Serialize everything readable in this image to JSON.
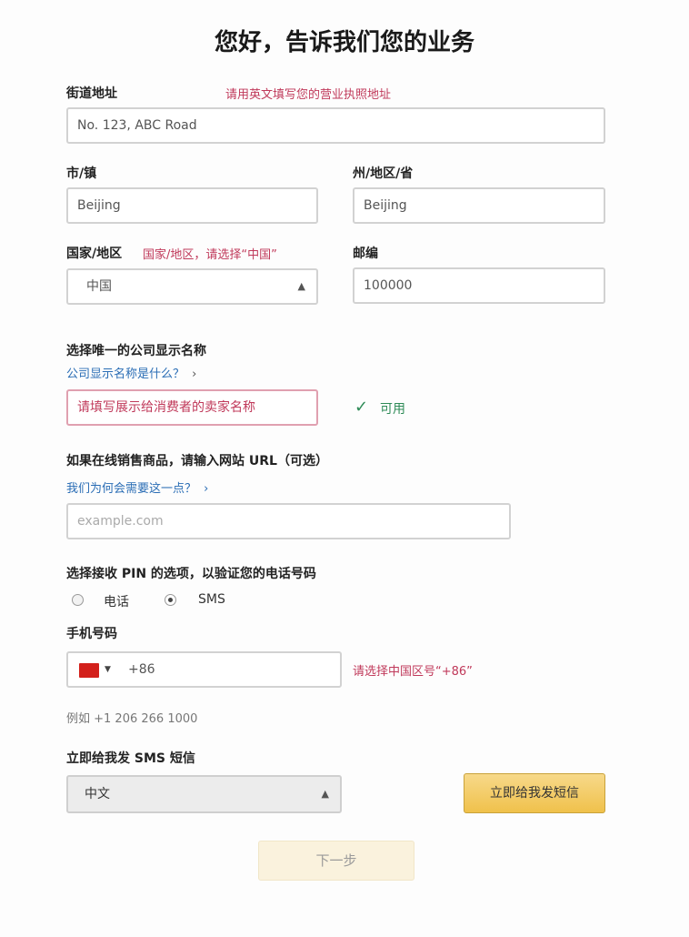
{
  "header": {
    "title": "您好，告诉我们您的业务"
  },
  "address": {
    "label": "街道地址",
    "hint": "请用英文填写您的营业执照地址",
    "value": "No. 123, ABC Road"
  },
  "city": {
    "label": "市/镇",
    "value": "Beijing"
  },
  "state": {
    "label": "州/地区/省",
    "value": "Beijing"
  },
  "country": {
    "label": "国家/地区",
    "hint": "国家/地区，请选择“中国”",
    "value": "中国"
  },
  "postal": {
    "label": "邮编",
    "value": "100000"
  },
  "display_name": {
    "label": "选择唯一的公司显示名称",
    "help_link": "公司显示名称是什么？",
    "placeholder": "请填写展示给消费者的卖家名称",
    "status_text": "可用"
  },
  "website": {
    "label": "如果在线销售商品，请输入网站 URL（可选）",
    "help_link": "我们为何会需要这一点？",
    "placeholder": "example.com"
  },
  "pin": {
    "label": "选择接收 PIN 的选项，以验证您的电话号码",
    "options": [
      {
        "label": "电话",
        "selected": false
      },
      {
        "label": "SMS",
        "selected": true
      }
    ]
  },
  "phone": {
    "label": "手机号码",
    "country_code": "+86",
    "hint": "请选择中国区号“+86”",
    "example": "例如 +1 206 266 1000"
  },
  "sms_language": {
    "label": "立即给我发 SMS 短信",
    "value": "中文"
  },
  "buttons": {
    "verify_label": "立即给我发短信",
    "next_label": "下一步"
  },
  "colors": {
    "hint_red": "#c0395a",
    "link_blue": "#2a6db5",
    "success_green": "#2e8b57",
    "button_yellow": "#f0c14b"
  },
  "icons": {
    "check": "checkmark-icon",
    "flag": "china-flag-icon",
    "select_arrow": "updown-arrow-icon"
  }
}
